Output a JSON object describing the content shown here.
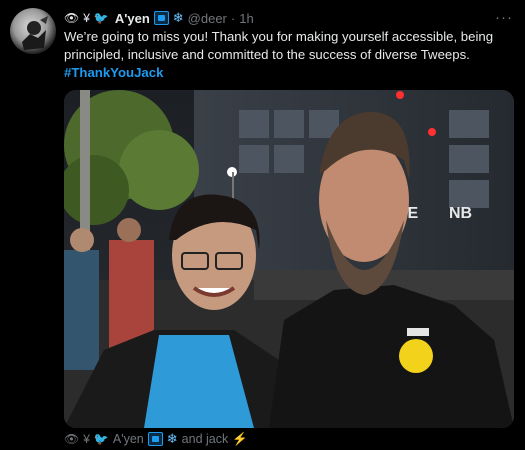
{
  "header": {
    "prefix_icons": [
      "eye-icon",
      "yen-icon",
      "bird-icon"
    ],
    "prefix_glyphs": [
      "👁",
      "¥",
      "🐦"
    ],
    "display_name": "A'yen",
    "handle": "@deer",
    "separator": "·",
    "time": "1h",
    "more_label": "···"
  },
  "tweet": {
    "text": "We’re going to miss you! Thank you for making yourself accessible, being principled, inclusive and committed to the success of diverse Tweeps.",
    "hashtag": "#ThankYouJack"
  },
  "footer": {
    "names": "A'yen",
    "and_label": "and jack",
    "bolt": "⚡"
  },
  "colors": {
    "background": "#000000",
    "text": "#e7e9ea",
    "muted": "#71767b",
    "link": "#1d9bf0"
  }
}
